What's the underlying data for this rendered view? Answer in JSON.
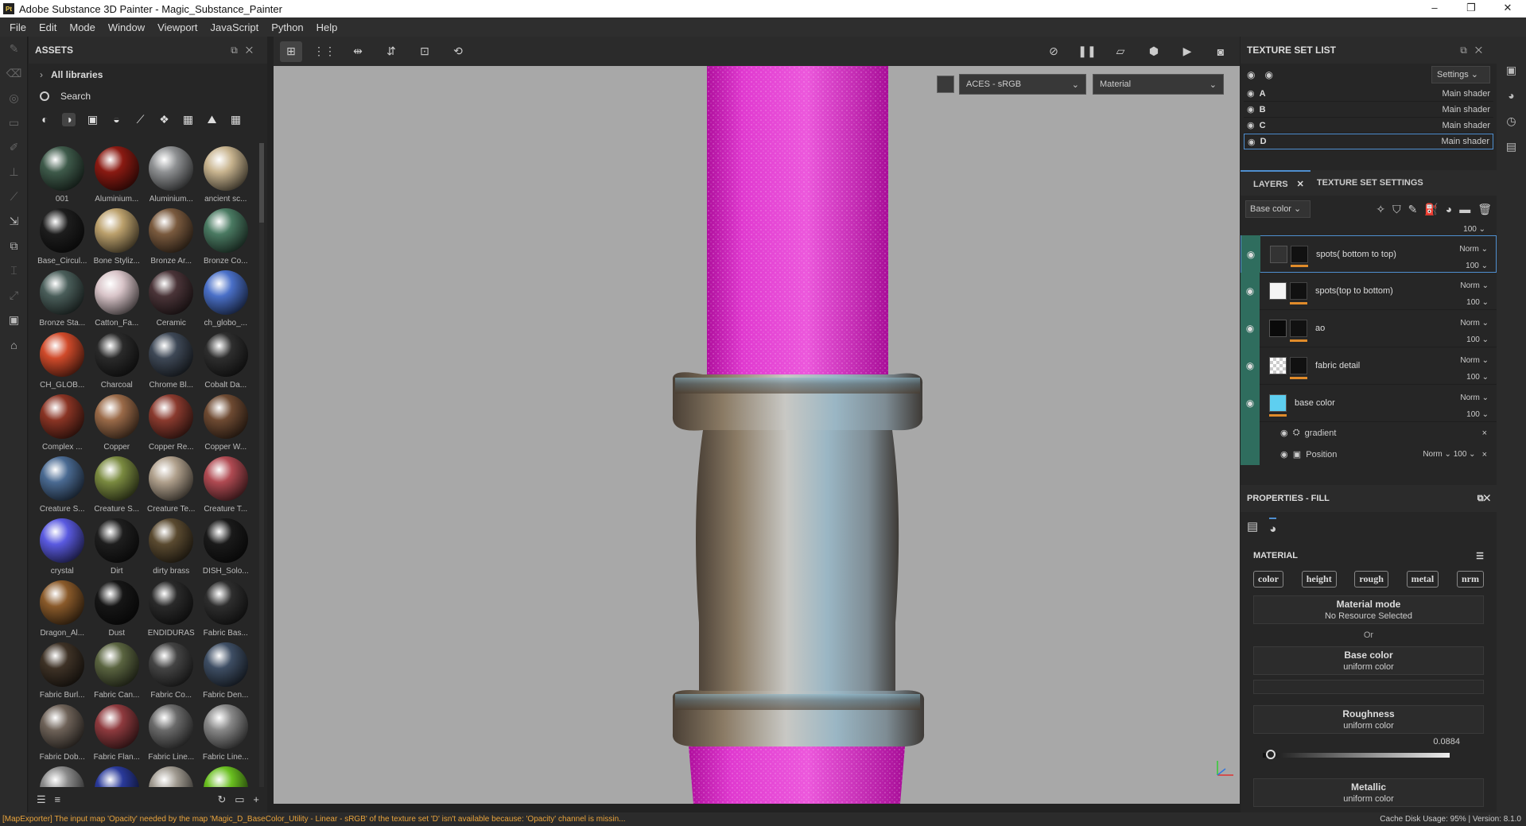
{
  "window": {
    "title": "Adobe Substance 3D Painter - Magic_Substance_Painter",
    "app_icon": "Pt",
    "controls": [
      "–",
      "❐",
      "✕"
    ]
  },
  "menu": [
    "File",
    "Edit",
    "Mode",
    "Window",
    "Viewport",
    "JavaScript",
    "Python",
    "Help"
  ],
  "assets": {
    "title": "ASSETS",
    "all_libraries": "All libraries",
    "search_label": "Search",
    "materials": [
      {
        "name": "001",
        "color": "#3e5a4a"
      },
      {
        "name": "Aluminium...",
        "color": "#8a1a12"
      },
      {
        "name": "Aluminium...",
        "color": "#8e9092"
      },
      {
        "name": "ancient sc...",
        "color": "#c8b48f"
      },
      {
        "name": "Base_Circul...",
        "color": "#1d1d1d"
      },
      {
        "name": "Bone Styliz...",
        "color": "#bba06c"
      },
      {
        "name": "Bronze Ar...",
        "color": "#7a5a3e"
      },
      {
        "name": "Bronze Co...",
        "color": "#4a7a62"
      },
      {
        "name": "Bronze Sta...",
        "color": "#4a5e5a"
      },
      {
        "name": "Catton_Fa...",
        "color": "#d8c4c8"
      },
      {
        "name": "Ceramic",
        "color": "#4a3438"
      },
      {
        "name": "ch_globo_...",
        "color": "#4a70c8"
      },
      {
        "name": "CH_GLOB...",
        "color": "#d04a2a"
      },
      {
        "name": "Charcoal",
        "color": "#2a2a2a"
      },
      {
        "name": "Chrome Bl...",
        "color": "#3e4856"
      },
      {
        "name": "Cobalt Da...",
        "color": "#2e2e2e"
      },
      {
        "name": "Complex ...",
        "color": "#8a3424"
      },
      {
        "name": "Copper",
        "color": "#9a6a48"
      },
      {
        "name": "Copper Re...",
        "color": "#8a3a2e"
      },
      {
        "name": "Copper W...",
        "color": "#6e4a32"
      },
      {
        "name": "Creature S...",
        "color": "#4a6a92"
      },
      {
        "name": "Creature S...",
        "color": "#7a8a40"
      },
      {
        "name": "Creature Te...",
        "color": "#b0a08c"
      },
      {
        "name": "Creature T...",
        "color": "#b04a52"
      },
      {
        "name": "crystal",
        "color": "#5a5ae0"
      },
      {
        "name": "Dirt",
        "color": "#1e1e1e"
      },
      {
        "name": "dirty brass",
        "color": "#5a4a30"
      },
      {
        "name": "DISH_Solo...",
        "color": "#1a1a1a"
      },
      {
        "name": "Dragon_Al...",
        "color": "#8a5a2a"
      },
      {
        "name": "Dust",
        "color": "#161616"
      },
      {
        "name": "ENDIDURAS",
        "color": "#2a2a2a"
      },
      {
        "name": "Fabric Bas...",
        "color": "#2e2e2e"
      },
      {
        "name": "Fabric Burl...",
        "color": "#3e3226"
      },
      {
        "name": "Fabric Can...",
        "color": "#5a6440"
      },
      {
        "name": "Fabric Co...",
        "color": "#444"
      },
      {
        "name": "Fabric Den...",
        "color": "#3e4e64"
      },
      {
        "name": "Fabric Dob...",
        "color": "#6e6258"
      },
      {
        "name": "Fabric Flan...",
        "color": "#8e3a3e"
      },
      {
        "name": "Fabric Line...",
        "color": "#6a6a6a"
      },
      {
        "name": "Fabric Line...",
        "color": "#888"
      },
      {
        "name": "",
        "color": "#8a8a8a"
      },
      {
        "name": "",
        "color": "#2a3a9a"
      },
      {
        "name": "",
        "color": "#a09a90"
      },
      {
        "name": "",
        "color": "#6ac020"
      }
    ]
  },
  "viewport": {
    "colorspace": "ACES - sRGB",
    "mode": "Material"
  },
  "texture_set_list": {
    "title": "TEXTURE SET LIST",
    "settings_label": "Settings",
    "sets": [
      {
        "name": "A",
        "shader": "Main shader"
      },
      {
        "name": "B",
        "shader": "Main shader"
      },
      {
        "name": "C",
        "shader": "Main shader"
      },
      {
        "name": "D",
        "shader": "Main shader"
      }
    ]
  },
  "layers_panel": {
    "tab_layers": "LAYERS",
    "tab_tss": "TEXTURE SET SETTINGS",
    "channel": "Base color",
    "top_partial": {
      "opacity": "100"
    },
    "layers": [
      {
        "name": "spots( bottom to top)",
        "blend": "Norm",
        "opacity": "100"
      },
      {
        "name": "spots(top to bottom)",
        "blend": "Norm",
        "opacity": "100"
      },
      {
        "name": "ao",
        "blend": "Norm",
        "opacity": "100"
      },
      {
        "name": "fabric detail",
        "blend": "Norm",
        "opacity": "100"
      },
      {
        "name": "base color",
        "blend": "Norm",
        "opacity": "100"
      }
    ],
    "sub": [
      {
        "name": "gradient"
      },
      {
        "name": "Position",
        "blend": "Norm",
        "opacity": "100"
      }
    ]
  },
  "properties": {
    "title": "PROPERTIES - FILL",
    "material_label": "MATERIAL",
    "channels": [
      "color",
      "height",
      "rough",
      "metal",
      "nrm"
    ],
    "material_mode": "Material mode",
    "no_resource": "No Resource Selected",
    "or": "Or",
    "base_color": "Base color",
    "base_color_sub": "uniform color",
    "roughness": "Roughness",
    "roughness_sub": "uniform color",
    "roughness_value": "0.0884",
    "metallic": "Metallic",
    "metallic_sub": "uniform color"
  },
  "status": {
    "message": "[MapExporter] The input map 'Opacity' needed by the map 'Magic_D_BaseColor_Utility - Linear - sRGB' of the texture set 'D' isn't available because: 'Opacity' channel is missin...",
    "cache": "Cache Disk Usage:   95% | Version: 8.1.0"
  }
}
